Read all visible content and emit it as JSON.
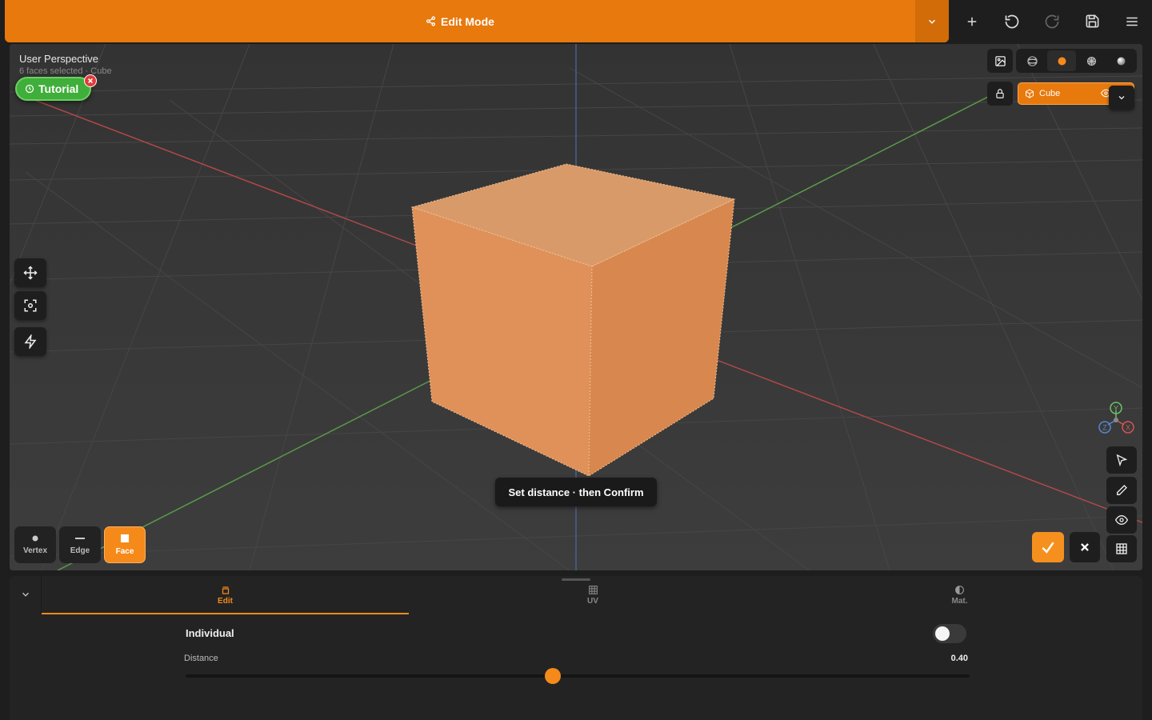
{
  "topbar": {
    "mode_label": "Edit Mode",
    "icons": [
      "share-icon",
      "chevron-down-icon",
      "plus-icon",
      "undo-icon",
      "redo-icon",
      "save-icon",
      "menu-icon"
    ],
    "accent_color": "#e8790c"
  },
  "viewport": {
    "title": "User Perspective",
    "subtitle": "6 faces selected · Cube",
    "tutorial_label": "Tutorial",
    "toast": "Set distance · then Confirm",
    "object_name": "Cube",
    "axes": {
      "x_label": "X",
      "y_label": "Y",
      "z_label": "Z"
    },
    "shading_modes": [
      "wireframe",
      "solid",
      "material",
      "rendered"
    ],
    "active_shading": "solid",
    "selection_modes": [
      {
        "label": "Vertex",
        "active": false
      },
      {
        "label": "Edge",
        "active": false
      },
      {
        "label": "Face",
        "active": true
      }
    ]
  },
  "panel": {
    "tabs": [
      {
        "label": "Edit",
        "active": true
      },
      {
        "label": "UV",
        "active": false
      },
      {
        "label": "Mat.",
        "active": false
      }
    ],
    "individual_label": "Individual",
    "individual_on": false,
    "distance_label": "Distance",
    "distance_value": "0.40",
    "distance_fraction": 0.468
  }
}
